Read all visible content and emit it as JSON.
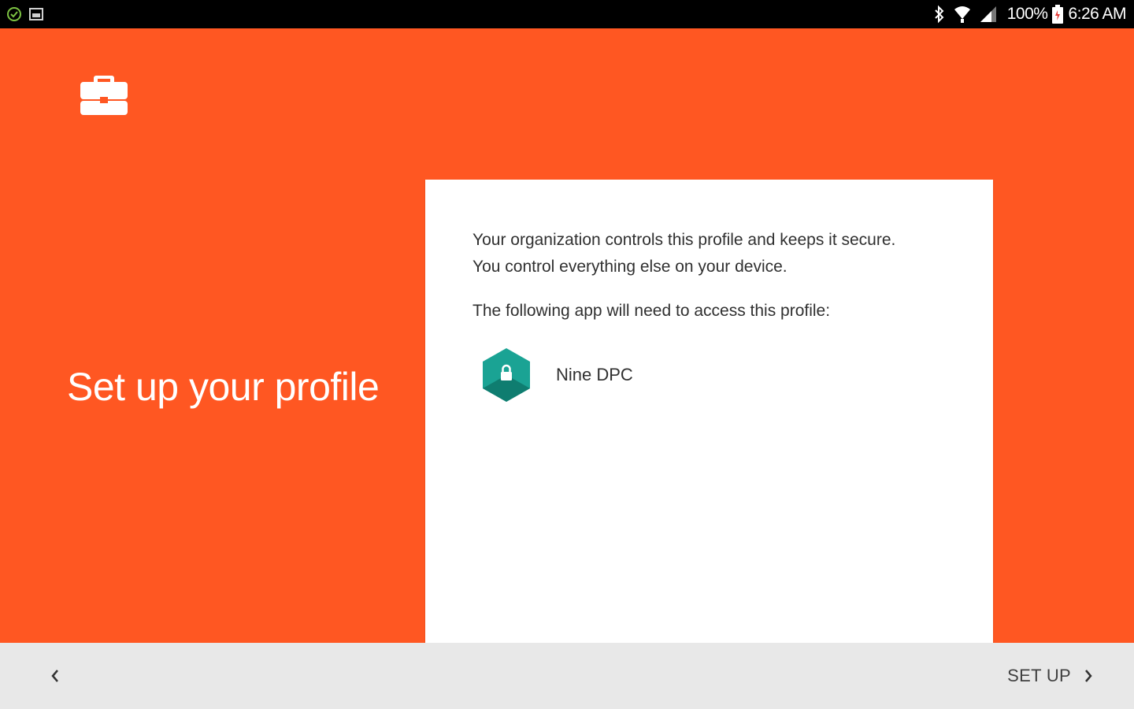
{
  "status_bar": {
    "battery_percent": "100%",
    "time": "6:26 AM",
    "icons": [
      "check-circle-icon",
      "image-icon",
      "bluetooth-icon",
      "wifi-icon",
      "signal-icon",
      "battery-icon"
    ]
  },
  "header": {
    "icon": "briefcase-icon",
    "title": "Set up your profile"
  },
  "card": {
    "description": "Your organization controls this profile and keeps it secure. You control everything else on your device.",
    "access_label": "The following app will need to access this profile:",
    "app": {
      "name": "Nine DPC",
      "icon": "lock-hexagon-icon"
    }
  },
  "nav": {
    "back_icon": "chevron-left-icon",
    "next_label": "SET UP",
    "next_icon": "chevron-right-icon"
  },
  "colors": {
    "background": "#ff5722",
    "status_bar": "#000000",
    "card": "#ffffff",
    "bottom_bar": "#e8e8e8",
    "app_icon_primary": "#1aa394",
    "app_icon_dark": "#0f7d70"
  }
}
